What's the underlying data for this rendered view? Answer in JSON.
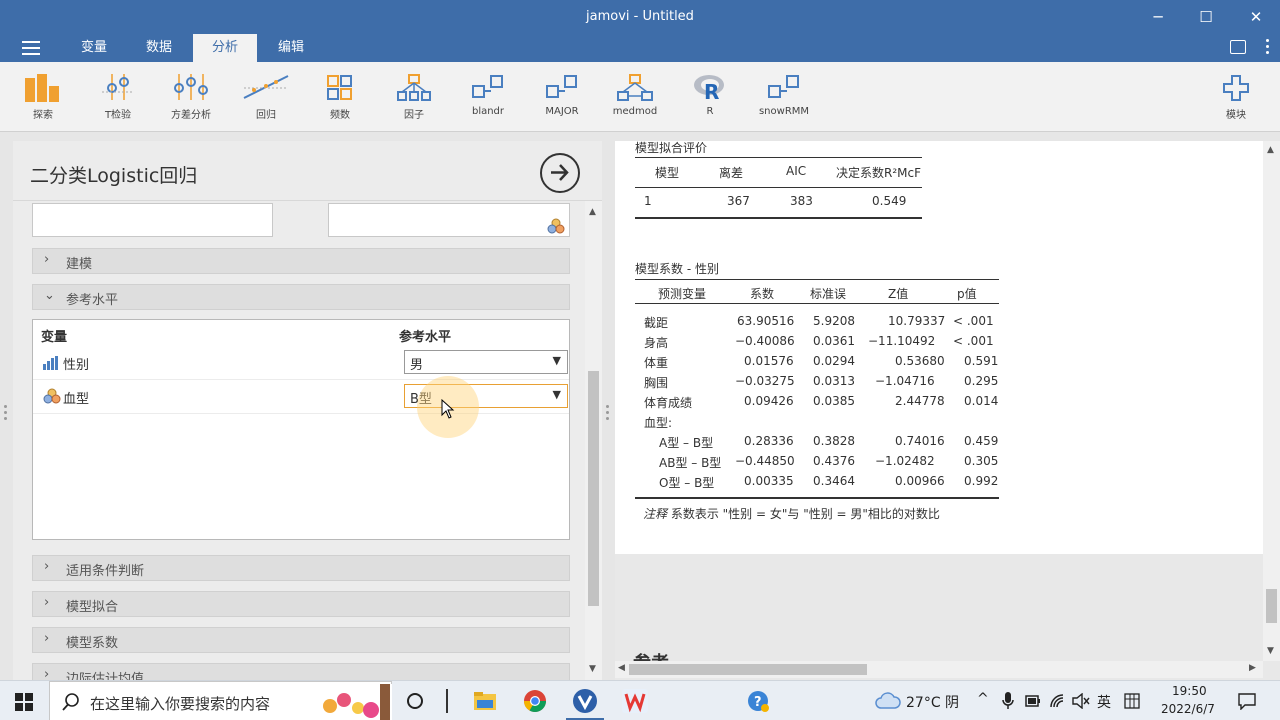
{
  "window": {
    "title": "jamovi - Untitled"
  },
  "menu": {
    "tabs": [
      "变量",
      "数据",
      "分析",
      "编辑"
    ],
    "active": "分析"
  },
  "ribbon": {
    "items": [
      "探索",
      "T检验",
      "方差分析",
      "回归",
      "频数",
      "因子",
      "blandr",
      "MAJOR",
      "medmod",
      "R",
      "snowRMM"
    ],
    "modules_label": "模块"
  },
  "analysis": {
    "title": "二分类Logistic回归",
    "sections": {
      "modeling": "建模",
      "reference_levels": "参考水平",
      "assumptions": "适用条件判断",
      "model_fit": "模型拟合",
      "model_coef": "模型系数",
      "marginal": "边际估计均值"
    },
    "ref_table": {
      "col_var": "变量",
      "col_ref": "参考水平",
      "rows": [
        {
          "name": "性别",
          "value": "男"
        },
        {
          "name": "血型",
          "value": "B型"
        }
      ]
    }
  },
  "results": {
    "fit": {
      "title": "模型拟合评价",
      "headers": [
        "模型",
        "离差",
        "AIC",
        "决定系数R²McF"
      ],
      "row": [
        "1",
        "367",
        "383",
        "0.549"
      ]
    },
    "coef": {
      "title": "模型系数 - 性别",
      "headers": [
        "预测变量",
        "系数",
        "标准误",
        "Z值",
        "p值"
      ],
      "rows": [
        [
          "截距",
          "63.90516",
          "5.9208",
          "10.79337",
          "< .001"
        ],
        [
          "身高",
          "−0.40086",
          "0.0361",
          "−11.10492",
          "< .001"
        ],
        [
          "体重",
          "0.01576",
          "0.0294",
          "0.53680",
          "0.591"
        ],
        [
          "胸围",
          "−0.03275",
          "0.0313",
          "−1.04716",
          "0.295"
        ],
        [
          "体育成绩",
          "0.09426",
          "0.0385",
          "2.44778",
          "0.014"
        ]
      ],
      "group_label": "血型:",
      "group_rows": [
        [
          "A型 – B型",
          "0.28336",
          "0.3828",
          "0.74016",
          "0.459"
        ],
        [
          "AB型 – B型",
          "−0.44850",
          "0.4376",
          "−1.02482",
          "0.305"
        ],
        [
          "O型 – B型",
          "0.00335",
          "0.3464",
          "0.00966",
          "0.992"
        ]
      ],
      "note_label": "注释",
      "note_text": "系数表示 \"性别 = 女\"与 \"性别 = 男\"相比的对数比"
    },
    "refs_heading": "参考"
  },
  "taskbar": {
    "search_placeholder": "在这里输入你要搜索的内容",
    "weather": "27°C 阴",
    "ime": "英",
    "time": "19:50",
    "date": "2022/6/7"
  },
  "colors": {
    "titlebar": "#3e6da9",
    "accent_orange": "#e8a033"
  }
}
